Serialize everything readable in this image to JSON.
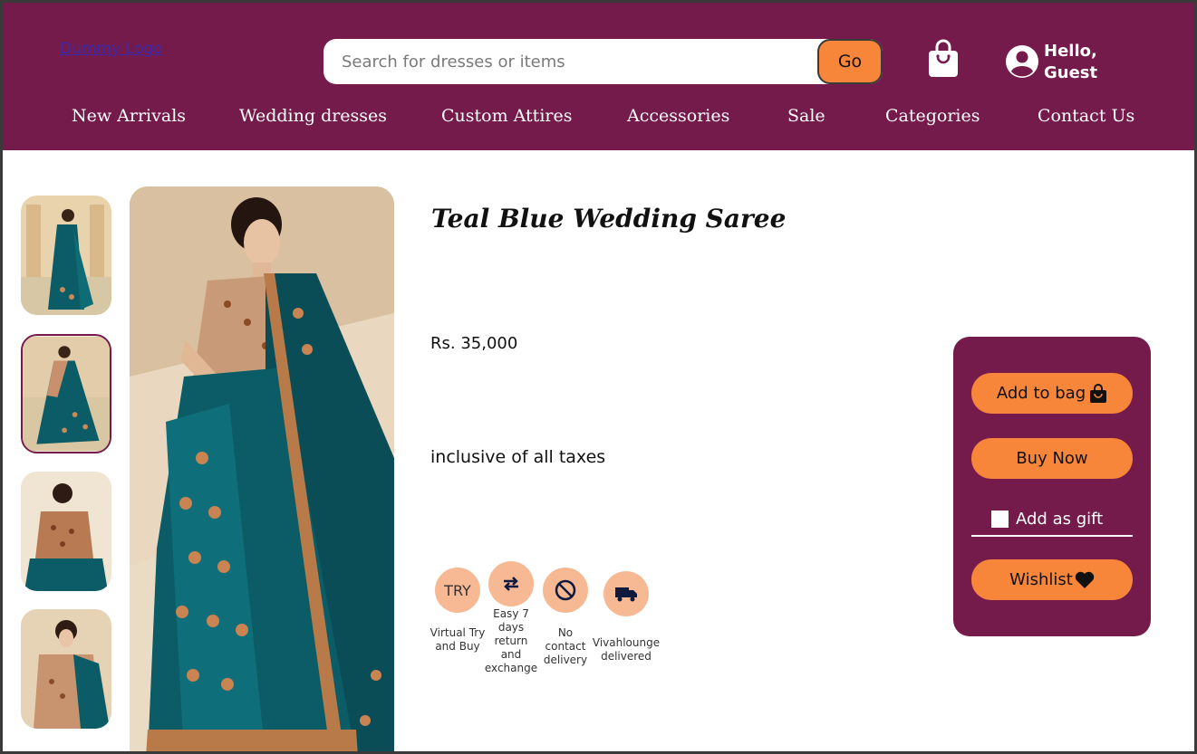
{
  "header": {
    "logo_text": "Dummy Logo",
    "search": {
      "placeholder": "Search for dresses or items",
      "go_label": "Go"
    },
    "greeting": "Hello, Guest"
  },
  "nav": [
    "New Arrivals",
    "Wedding dresses",
    "Custom Attires",
    "Accessories",
    "Sale",
    "Categories",
    "Contact Us"
  ],
  "product": {
    "title": "Teal Blue Wedding Saree",
    "price": "Rs. 35,000",
    "tax_note": "inclusive of all taxes",
    "selected_thumbnail": 2
  },
  "features": [
    {
      "icon": "TRY",
      "label": "Virtual Try and Buy"
    },
    {
      "icon": "swap-arrows-icon",
      "label": "Easy 7 days return and exchange"
    },
    {
      "icon": "no-contact-icon",
      "label": "No contact delivery"
    },
    {
      "icon": "truck-icon",
      "label": "Vivahlounge delivered"
    }
  ],
  "panel": {
    "add_to_bag": "Add to bag",
    "buy_now": "Buy Now",
    "gift": "Add as gift",
    "wishlist": "Wishlist"
  },
  "colors": {
    "brand": "#741b4c",
    "accent": "#f7853a",
    "feature_bg": "#f7b894",
    "saree": "#0b5c66"
  }
}
